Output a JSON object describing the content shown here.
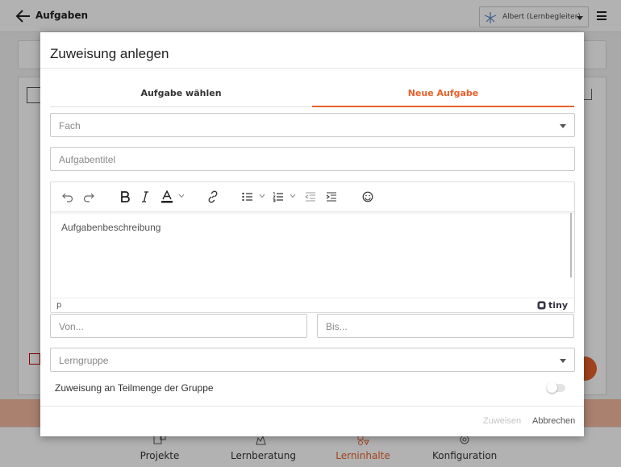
{
  "app": {
    "title": "Aufgaben",
    "user": "Albert (Lernbegleiter)",
    "nav": [
      {
        "label": "Projekte",
        "icon": "projects-icon"
      },
      {
        "label": "Lernberatung",
        "icon": "counseling-icon"
      },
      {
        "label": "Lerninhalte",
        "icon": "learning-content-icon",
        "active": true
      },
      {
        "label": "Konfiguration",
        "icon": "settings-gear-icon"
      }
    ]
  },
  "modal": {
    "title": "Zuweisung anlegen",
    "tabs": [
      {
        "label": "Aufgabe wählen",
        "active": false
      },
      {
        "label": "Neue Aufgabe",
        "active": true
      }
    ],
    "subject_placeholder": "Fach",
    "task_title_placeholder": "Aufgabentitel",
    "editor": {
      "placeholder": "Aufgabenbeschreibung",
      "status_path": "p",
      "brand": "tiny"
    },
    "from_placeholder": "Von...",
    "to_placeholder": "Bis...",
    "group_placeholder": "Lerngruppe",
    "subset_toggle_label": "Zuweisung an Teilmenge der Gruppe",
    "subset_toggle_on": false,
    "assign_label": "Zuweisen",
    "cancel_label": "Abbrechen"
  },
  "colors": {
    "accent": "#e8602c",
    "disabled": "#c4c4c4"
  }
}
